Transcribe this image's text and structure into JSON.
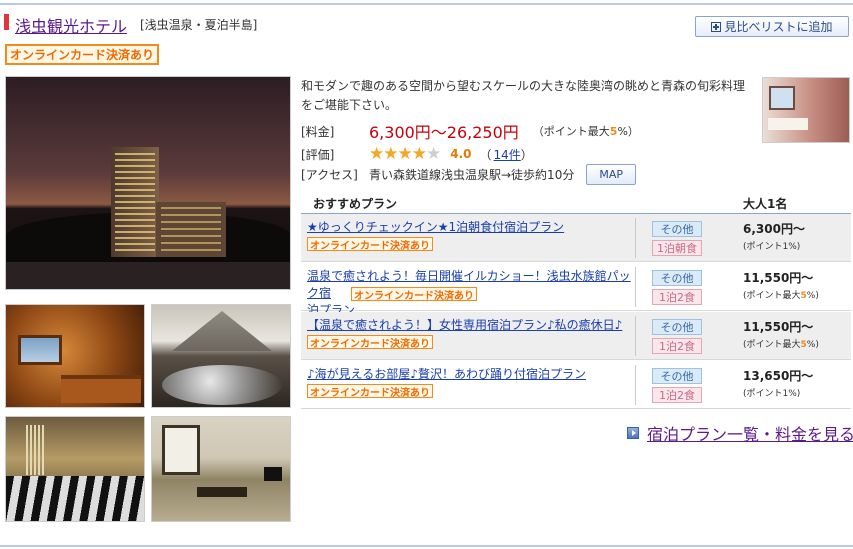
{
  "hotel": {
    "name": "浅虫観光ホテル",
    "area": "[浅虫温泉・夏泊半島]",
    "compare_button": "見比べリストに追加",
    "card_badge": "オンラインカード決済あり",
    "description": "和モダンで趣のある空間から望むスケールの大きな陸奥湾の眺めと青森の旬彩料理をご堪能下さい。",
    "price_label": "[料金]",
    "price": "6,300円〜26,250円",
    "price_points_prefix": "（ポイント最大",
    "price_points_rate": "5",
    "price_points_suffix": "%）",
    "rating_label": "[評価]",
    "rating_stars": "★★★★",
    "rating_stars_off": "★",
    "rating_score": "4.0",
    "review_open": "（",
    "review_count": "14件",
    "review_close": "）",
    "access_label": "[アクセス]",
    "access": "青い森鉄道線浅虫温泉駅→徒歩約10分",
    "map_button": "MAP"
  },
  "plans": {
    "header_plan": "おすすめプラン",
    "header_price": "大人1名",
    "rows": [
      {
        "title": "★ゆっくりチェックイン★1泊朝食付宿泊プラン",
        "badge": "オンラインカード決済あり",
        "type": "その他",
        "meal": "1泊朝食",
        "price": "6,300円〜",
        "point_prefix": "(ポイント1",
        "point_rate": "",
        "point_suffix": "%)"
      },
      {
        "title_line1": "温泉で癒されよう！毎日開催イルカショー！浅虫水族館パック宿",
        "title_line2": "泊プラン",
        "badge": "オンラインカード決済あり",
        "type": "その他",
        "meal": "1泊2食",
        "price": "11,550円〜",
        "point_prefix": "(ポイント最大",
        "point_rate": "5",
        "point_suffix": "%)"
      },
      {
        "title": "【温泉で癒されよう！】女性専用宿泊プラン♪私の癒休日♪",
        "badge": "オンラインカード決済あり",
        "type": "その他",
        "meal": "1泊2食",
        "price": "11,550円〜",
        "point_prefix": "(ポイント最大",
        "point_rate": "5",
        "point_suffix": "%)"
      },
      {
        "title": "♪海が見えるお部屋♪贅沢！あわび踊り付宿泊プラン",
        "badge": "オンラインカード決済あり",
        "type": "その他",
        "meal": "1泊2食",
        "price": "13,650円〜",
        "point_prefix": "(ポイント1",
        "point_rate": "",
        "point_suffix": "%)"
      }
    ],
    "all_plans_link": "宿泊プラン一覧・料金を見る"
  },
  "colors": {
    "accent_red": "#e0353b",
    "price_red": "#c8000b",
    "link_blue": "#1a3fae",
    "visited_purple": "#5a1a8c",
    "badge_orange": "#f08c1e"
  },
  "icons": [
    "plus-box-icon",
    "star-icon",
    "arrow-right-icon"
  ]
}
